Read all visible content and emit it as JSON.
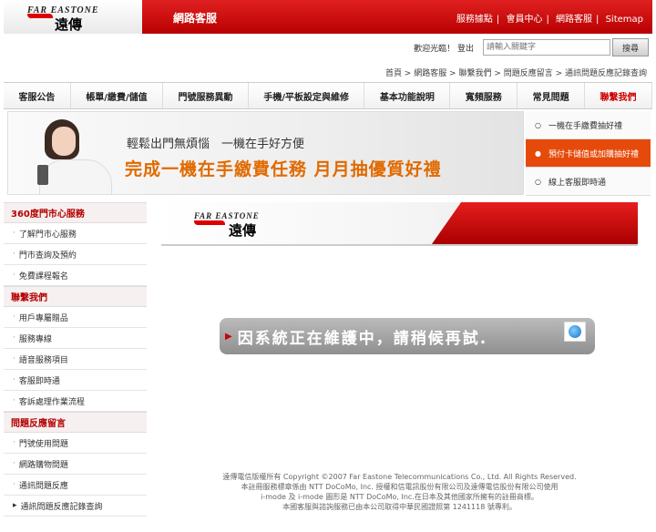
{
  "header": {
    "logo_en": "FAR EASTONE",
    "logo_zh": "遠傳",
    "title": "網路客服",
    "links": [
      "服務據點",
      "會員中心",
      "網路客服",
      "Sitemap"
    ]
  },
  "account": {
    "welcome": "歡迎光臨！",
    "logout": "登出",
    "search_placeholder": "請輸入關鍵字",
    "search_button": "搜尋"
  },
  "breadcrumb": "首頁 > 網路客服 > 聯繫我們 > 問題反應留言 > 通訊問題反應記錄查詢",
  "nav": {
    "items": [
      "客服公告",
      "帳單/繳費/儲值",
      "門號服務異動",
      "手機/平板設定與維修",
      "基本功能說明",
      "寬頻服務",
      "常見問題",
      "聯繫我們"
    ],
    "active": "聯繫我們"
  },
  "banner": {
    "line1": "輕鬆出門無煩惱　一機在手好方便",
    "line2": "完成一機在手繳費任務 月月抽優質好禮"
  },
  "promo_menu": [
    "一機在手繳費抽好禮",
    "預付卡儲值或加購抽好禮",
    "線上客服即時通"
  ],
  "sidebar": {
    "sections": [
      {
        "title": "360度門市心服務",
        "items": [
          "了解門市心服務",
          "門市查詢及預約",
          "免費課程報名"
        ]
      },
      {
        "title": "聯繫我們",
        "items": [
          "用戶專屬贈品",
          "服務專線",
          "語音服務項目",
          "客服即時通",
          "客訴處理作業流程"
        ]
      },
      {
        "title": "問題反應留言",
        "items": [
          "門號使用問題",
          "網路購物問題",
          "通訊問題反應",
          "通訊問題反應記錄查詢"
        ]
      }
    ]
  },
  "content": {
    "logo_en": "FAR EASTONE",
    "logo_zh": "遠傳",
    "maintenance": "因系統正在維護中，請稍候再試.",
    "footer": [
      "遠傳電信版權所有 Copyright ©2007 Far Eastone Telecommunications Co., Ltd. All Rights Reserved.",
      "本註冊服務標章係由 NTT DoCoMo, Inc. 授權和信電訊股份有限公司及遠傳電信股份有限公司使用",
      "i-mode 及 i-mode 圖形是 NTT DoCoMo, Inc.在日本及其他國家所擁有的註冊商標。",
      "本國客服與諮詢服務已由本公司取得中華民國證照第 1241118 號專利。"
    ]
  },
  "colors": {
    "brand_red": "#cc0000",
    "promo_orange": "#e64a0a",
    "banner_orange": "#e06a00"
  }
}
